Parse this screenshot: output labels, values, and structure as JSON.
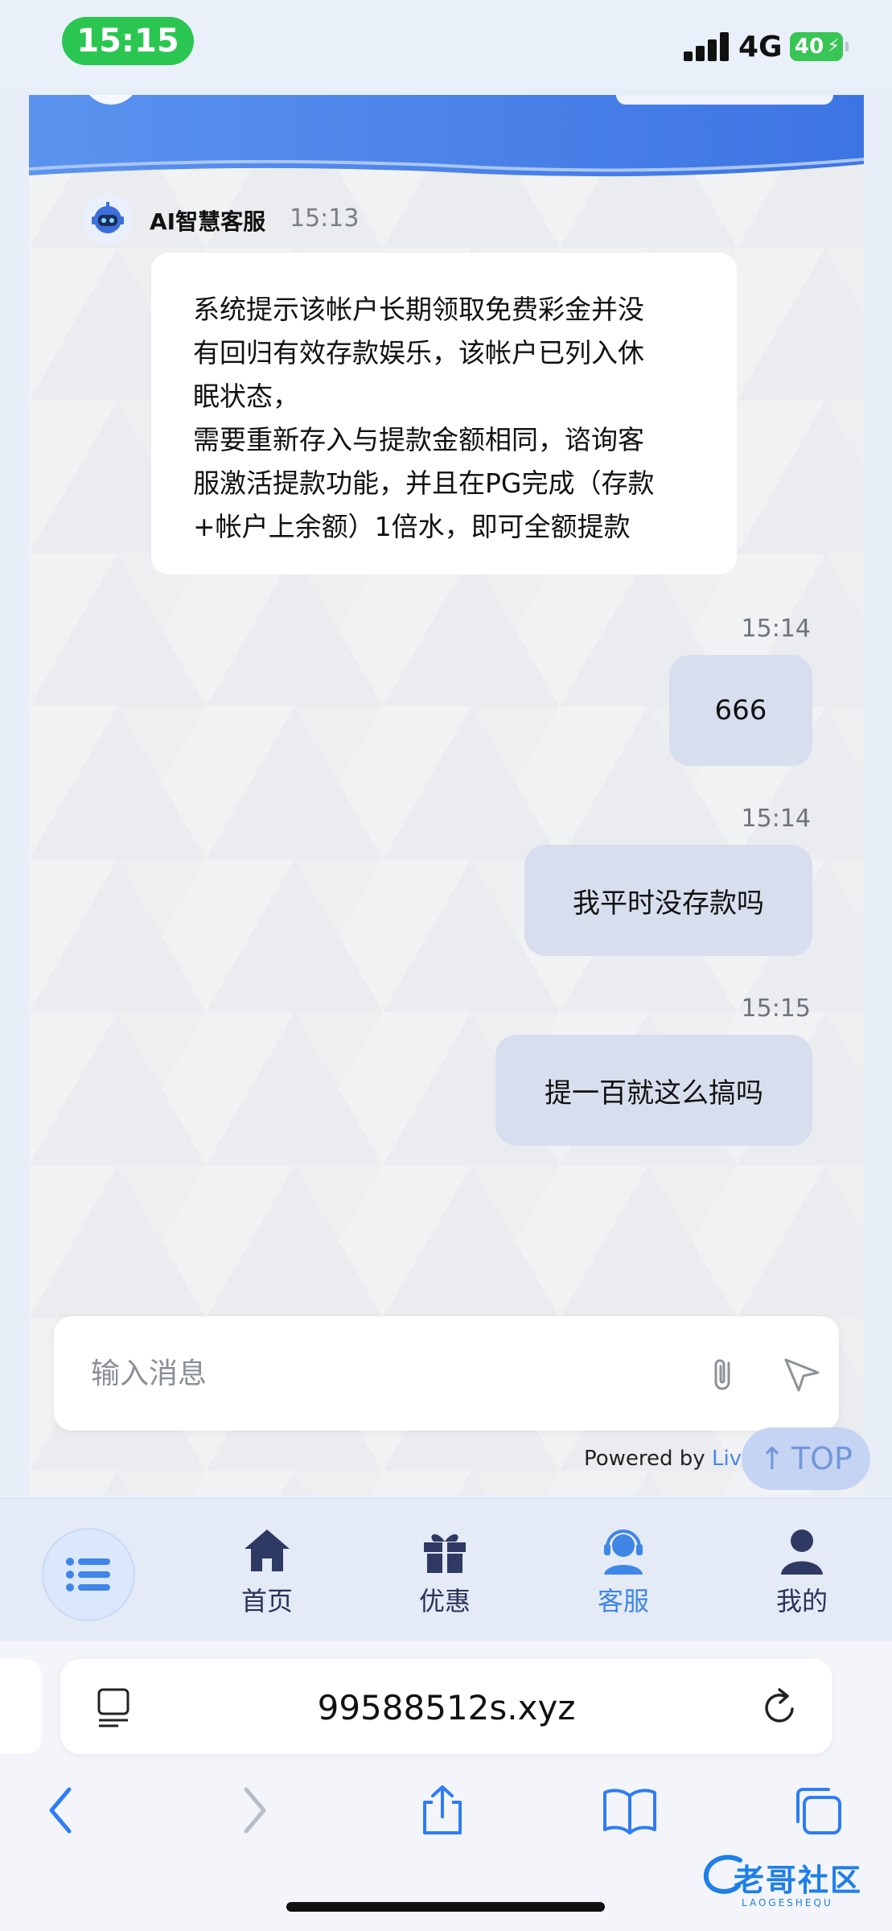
{
  "status_bar": {
    "time": "15:15",
    "network": "4G",
    "battery": "40"
  },
  "chat": {
    "bot": {
      "name": "AI智慧客服",
      "time": "15:13",
      "message": "系统提示该帐户长期领取免费彩金并没\n有回归有效存款娱乐，该帐户已列入休\n眠状态，\n需要重新存入与提款金额相同，谘询客\n服激活提款功能，并且在PG完成（存款\n+帐户上余额）1倍水，即可全额提款"
    },
    "user_messages": [
      {
        "time": "15:14",
        "text": "666"
      },
      {
        "time": "15:14",
        "text": "我平时没存款吗"
      },
      {
        "time": "15:15",
        "text": "提一百就这么搞吗"
      }
    ],
    "input_placeholder": "输入消息",
    "powered_by": "Powered by ",
    "powered_brand": "Liv",
    "top_button": "TOP"
  },
  "bottom_nav": {
    "items": [
      {
        "label": "首页",
        "icon": "home-icon"
      },
      {
        "label": "优惠",
        "icon": "gift-icon"
      },
      {
        "label": "客服",
        "icon": "headset-icon",
        "active": true
      },
      {
        "label": "我的",
        "icon": "user-icon"
      }
    ]
  },
  "browser": {
    "url": "99588512s.xyz"
  },
  "watermark": {
    "text": "老哥社区",
    "sub": "LAOGESHEQU"
  },
  "colors": {
    "accent": "#3f86e6",
    "status_green": "#2bc652",
    "user_bubble": "#d7deed"
  }
}
